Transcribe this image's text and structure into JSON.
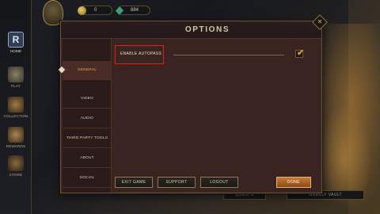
{
  "topbar": {
    "gold": "0",
    "gems": "884"
  },
  "nav": [
    {
      "label": "HOME",
      "icon": "home-icon"
    },
    {
      "label": "PLAY",
      "icon": "play-icon"
    },
    {
      "label": "COLLECTION",
      "icon": "collection-icon"
    },
    {
      "label": "REWARDS",
      "icon": "rewards-icon"
    },
    {
      "label": "STORE",
      "icon": "store-icon"
    }
  ],
  "dialog": {
    "title": "OPTIONS",
    "close_glyph": "✕",
    "tabs": [
      {
        "label": "GENERAL",
        "active": true
      },
      {
        "label": "VIDEO"
      },
      {
        "label": "AUDIO"
      },
      {
        "label": "THIRD PARTY TOOLS"
      },
      {
        "label": "ABOUT"
      },
      {
        "label": "SOCIAL"
      }
    ],
    "setting": {
      "label": "ENABLE AUTOPASS",
      "checked": true,
      "check_glyph": "✔"
    },
    "buttons": {
      "exit": "EXIT GAME",
      "support": "SUPPORT",
      "logout": "LOGOUT",
      "done": "DONE"
    }
  },
  "background": {
    "quests": "QUESTS",
    "vault": "WEEKLY VAULT"
  },
  "colors": {
    "accent": "#e89838",
    "highlight_box": "#e21f1f"
  }
}
